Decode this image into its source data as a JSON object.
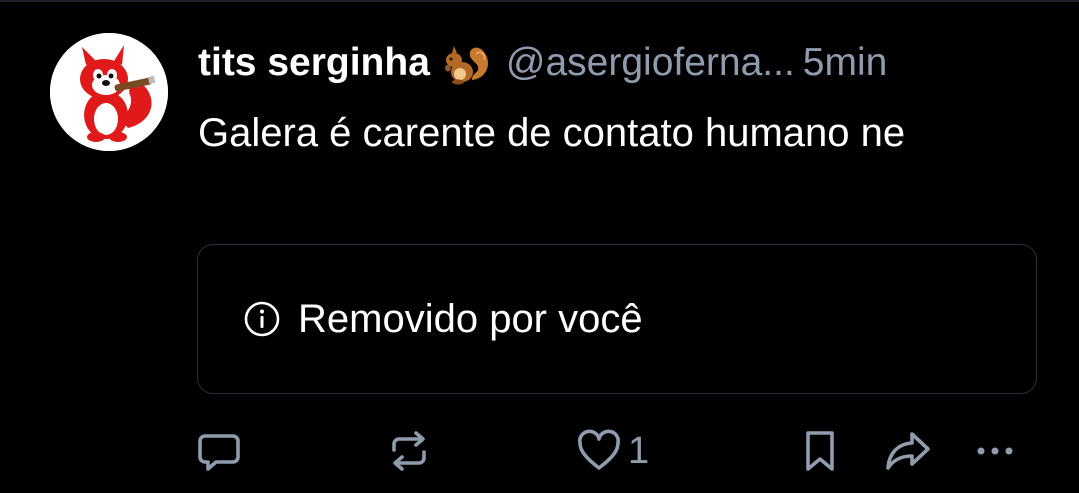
{
  "post": {
    "author": {
      "display_name": "tits serginha",
      "name_emoji": "squirrel-emoji",
      "handle": "@asergioferna...",
      "avatar": "red-squirrel-mascot"
    },
    "timestamp": "5min",
    "text": "Galera é carente de contato humano ne",
    "removed_notice": {
      "icon": "info-icon",
      "label": "Removido por você"
    },
    "actions": {
      "reply_icon": "reply-icon",
      "repost_icon": "repost-icon",
      "like_icon": "heart-icon",
      "like_count": "1",
      "bookmark_icon": "bookmark-icon",
      "share_icon": "share-icon",
      "more_icon": "more-icon"
    }
  },
  "colors": {
    "background": "#000000",
    "text_primary": "#ffffff",
    "text_secondary": "#8f9cae",
    "card_border": "#2a2f37"
  }
}
